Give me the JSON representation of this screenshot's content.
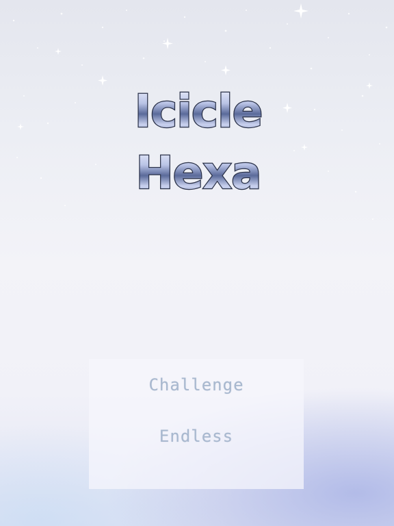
{
  "game": {
    "title_line1": "Icicle",
    "title_line2": "Hexa"
  },
  "menu": {
    "items": [
      {
        "label": "Challenge"
      },
      {
        "label": "Endless"
      }
    ]
  },
  "colors": {
    "menu_text": "#a8b8cf",
    "title_fill_light": "#f4f6ff",
    "title_fill_dark": "#5a6a9a",
    "title_outline": "#2a3148"
  }
}
